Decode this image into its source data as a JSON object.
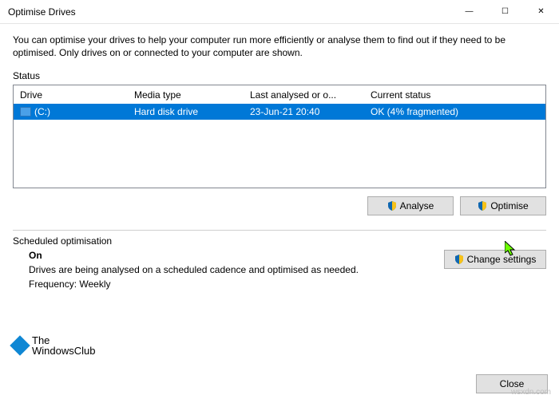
{
  "window": {
    "title": "Optimise Drives",
    "minimize": "—",
    "maximize": "☐",
    "close": "✕"
  },
  "intro": "You can optimise your drives to help your computer run more efficiently or analyse them to find out if they need to be optimised. Only drives on or connected to your computer are shown.",
  "status_label": "Status",
  "columns": {
    "drive": "Drive",
    "media": "Media type",
    "last": "Last analysed or o...",
    "status": "Current status"
  },
  "rows": [
    {
      "drive": "(C:)",
      "media": "Hard disk drive",
      "last": "23-Jun-21 20:40",
      "status": "OK (4% fragmented)"
    }
  ],
  "buttons": {
    "analyse": "Analyse",
    "optimise": "Optimise",
    "change_settings": "Change settings",
    "close": "Close"
  },
  "scheduled": {
    "label": "Scheduled optimisation",
    "on": "On",
    "desc": "Drives are being analysed on a scheduled cadence and optimised as needed.",
    "frequency": "Frequency: Weekly"
  },
  "branding": "The\nWindowsClub",
  "watermark": "wsxdn.com"
}
